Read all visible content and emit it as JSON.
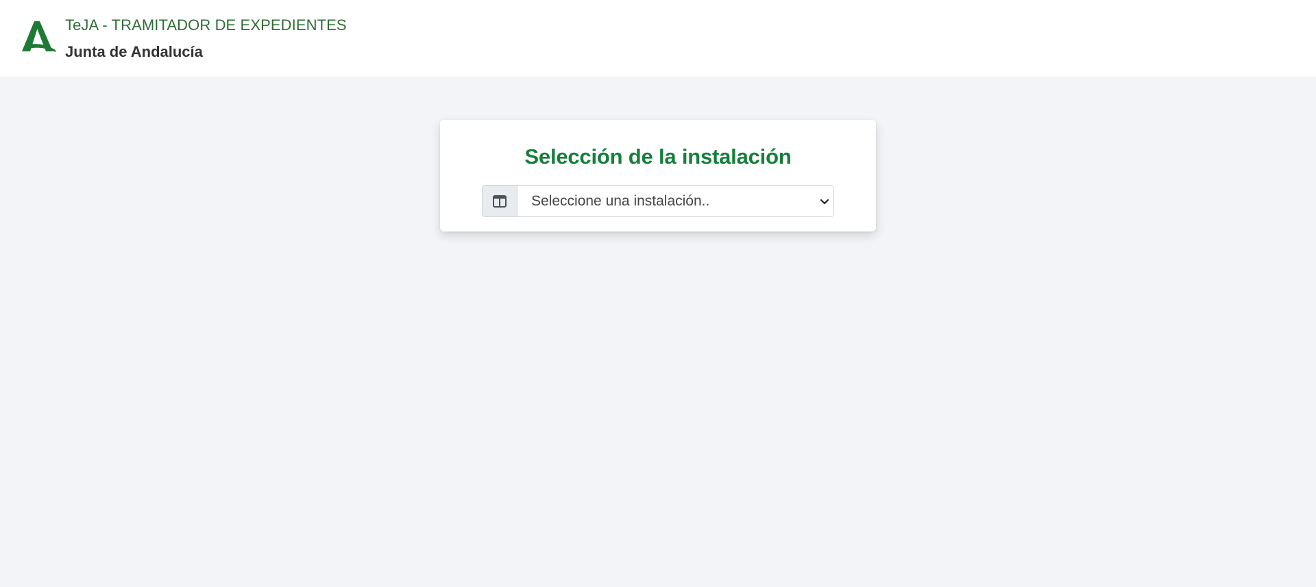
{
  "header": {
    "app_title": "TeJA - TRAMITADOR DE EXPEDIENTES",
    "org_name": "Junta de Andalucía",
    "logo_icon": "junta-andalucia-logo-icon",
    "brand_color": "#1e7a34"
  },
  "installation_card": {
    "title": "Selección de la instalación",
    "addon_icon": "columns-icon",
    "select": {
      "selected_value": "Seleccione una instalación..",
      "icon": "chevron-down-icon"
    },
    "title_color": "#157f3a"
  },
  "colors": {
    "page_background": "#f2f4f7",
    "header_background": "#ffffff"
  }
}
